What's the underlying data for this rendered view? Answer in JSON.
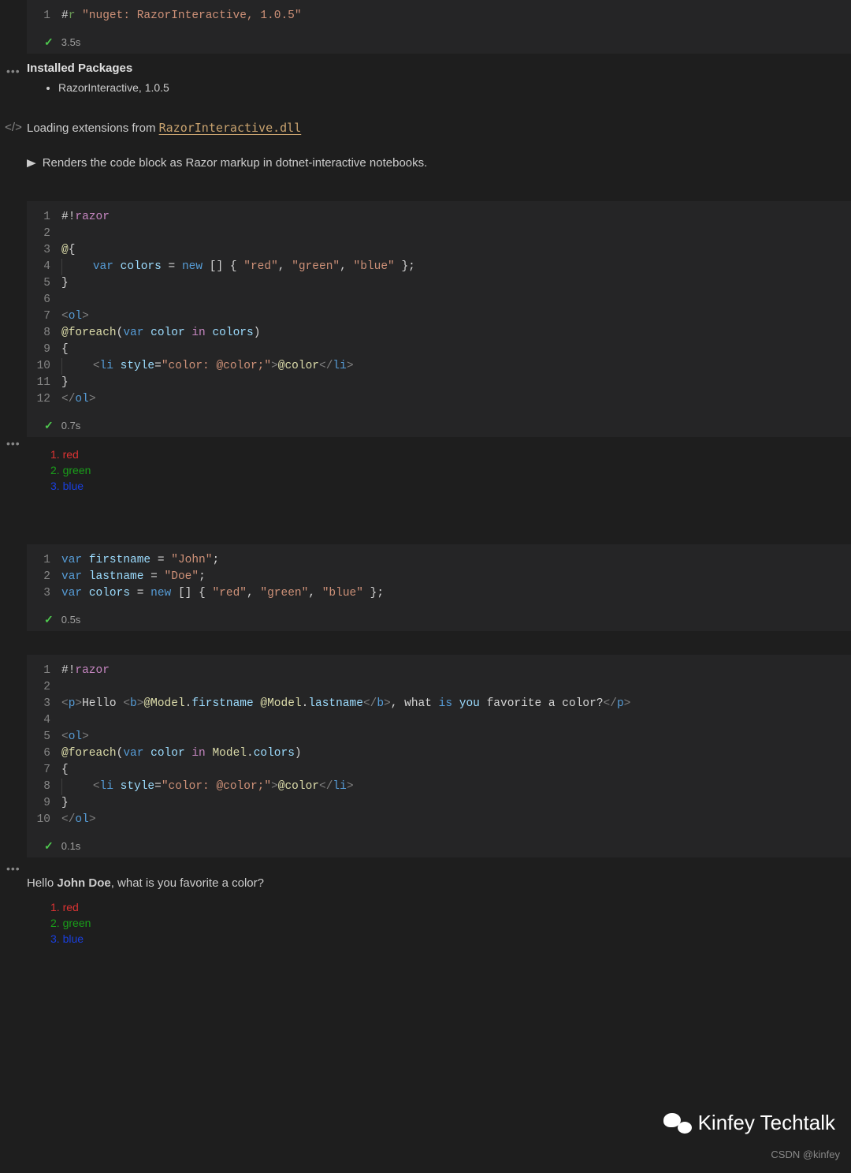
{
  "cell1": {
    "lines": [
      {
        "n": "1",
        "tokens": [
          [
            "pn",
            "#"
          ],
          [
            "cm",
            "r "
          ],
          [
            "str",
            "\"nuget: RazorInteractive, 1.0.5\""
          ]
        ]
      }
    ],
    "time": "3.5s"
  },
  "installed": {
    "heading": "Installed Packages",
    "items": [
      "RazorInteractive, 1.0.5"
    ]
  },
  "loading": {
    "prefix": "Loading extensions from ",
    "file": "RazorInteractive.dll"
  },
  "rendersLine": "Renders the code block as Razor markup in dotnet-interactive notebooks.",
  "cell2": {
    "lines": [
      {
        "n": "1",
        "tokens": [
          [
            "pn",
            "#!"
          ],
          [
            "pr",
            "razor"
          ]
        ]
      },
      {
        "n": "2",
        "tokens": []
      },
      {
        "n": "3",
        "tokens": [
          [
            "fn",
            "@"
          ],
          [
            "pn",
            "{"
          ]
        ]
      },
      {
        "n": "4",
        "tokens": [
          [
            "gut",
            " "
          ],
          [
            "pn",
            "   "
          ],
          [
            "kw",
            "var"
          ],
          [
            "pn",
            " "
          ],
          [
            "vr",
            "colors"
          ],
          [
            "pn",
            " = "
          ],
          [
            "kw",
            "new"
          ],
          [
            "pn",
            " [] { "
          ],
          [
            "str",
            "\"red\""
          ],
          [
            "pn",
            ", "
          ],
          [
            "str",
            "\"green\""
          ],
          [
            "pn",
            ", "
          ],
          [
            "str",
            "\"blue\""
          ],
          [
            "pn",
            " };"
          ]
        ]
      },
      {
        "n": "5",
        "tokens": [
          [
            "pn",
            "}"
          ]
        ]
      },
      {
        "n": "6",
        "tokens": []
      },
      {
        "n": "7",
        "tokens": [
          [
            "ang",
            "<"
          ],
          [
            "tag",
            "ol"
          ],
          [
            "ang",
            ">"
          ]
        ]
      },
      {
        "n": "8",
        "tokens": [
          [
            "fn",
            "@foreach"
          ],
          [
            "pn",
            "("
          ],
          [
            "kw",
            "var"
          ],
          [
            "pn",
            " "
          ],
          [
            "vr",
            "color"
          ],
          [
            "pn",
            " "
          ],
          [
            "pr",
            "in"
          ],
          [
            "pn",
            " "
          ],
          [
            "vr",
            "colors"
          ],
          [
            "pn",
            ")"
          ]
        ]
      },
      {
        "n": "9",
        "tokens": [
          [
            "pn",
            "{"
          ]
        ]
      },
      {
        "n": "10",
        "tokens": [
          [
            "gut",
            " "
          ],
          [
            "pn",
            "   "
          ],
          [
            "ang",
            "<"
          ],
          [
            "tag",
            "li"
          ],
          [
            "pn",
            " "
          ],
          [
            "attr",
            "style"
          ],
          [
            "pn",
            "="
          ],
          [
            "str",
            "\"color: @color;\""
          ],
          [
            "ang",
            ">"
          ],
          [
            "fn",
            "@color"
          ],
          [
            "ang",
            "</"
          ],
          [
            "tag",
            "li"
          ],
          [
            "ang",
            ">"
          ]
        ]
      },
      {
        "n": "11",
        "tokens": [
          [
            "pn",
            "}"
          ]
        ]
      },
      {
        "n": "12",
        "tokens": [
          [
            "ang",
            "</"
          ],
          [
            "tag",
            "ol"
          ],
          [
            "ang",
            ">"
          ]
        ]
      }
    ],
    "time": "0.7s"
  },
  "output1": [
    {
      "n": "1.",
      "label": "red",
      "color": "#dd3333"
    },
    {
      "n": "2.",
      "label": "green",
      "color": "#1a9e1a"
    },
    {
      "n": "3.",
      "label": "blue",
      "color": "#1a3fdd"
    }
  ],
  "cell3": {
    "lines": [
      {
        "n": "1",
        "tokens": [
          [
            "kw",
            "var"
          ],
          [
            "pn",
            " "
          ],
          [
            "vr",
            "firstname"
          ],
          [
            "pn",
            " = "
          ],
          [
            "str",
            "\"John\""
          ],
          [
            "pn",
            ";"
          ]
        ]
      },
      {
        "n": "2",
        "tokens": [
          [
            "kw",
            "var"
          ],
          [
            "pn",
            " "
          ],
          [
            "vr",
            "lastname"
          ],
          [
            "pn",
            " = "
          ],
          [
            "str",
            "\"Doe\""
          ],
          [
            "pn",
            ";"
          ]
        ]
      },
      {
        "n": "3",
        "tokens": [
          [
            "kw",
            "var"
          ],
          [
            "pn",
            " "
          ],
          [
            "vr",
            "colors"
          ],
          [
            "pn",
            " = "
          ],
          [
            "kw",
            "new"
          ],
          [
            "pn",
            " [] { "
          ],
          [
            "str",
            "\"red\""
          ],
          [
            "pn",
            ", "
          ],
          [
            "str",
            "\"green\""
          ],
          [
            "pn",
            ", "
          ],
          [
            "str",
            "\"blue\""
          ],
          [
            "pn",
            " };"
          ]
        ]
      }
    ],
    "time": "0.5s"
  },
  "cell4": {
    "lines": [
      {
        "n": "1",
        "tokens": [
          [
            "pn",
            "#!"
          ],
          [
            "pr",
            "razor"
          ]
        ]
      },
      {
        "n": "2",
        "tokens": []
      },
      {
        "n": "3",
        "tokens": [
          [
            "ang",
            "<"
          ],
          [
            "tag",
            "p"
          ],
          [
            "ang",
            ">"
          ],
          [
            "pn",
            "Hello "
          ],
          [
            "ang",
            "<"
          ],
          [
            "tag",
            "b"
          ],
          [
            "ang",
            ">"
          ],
          [
            "fn",
            "@Model"
          ],
          [
            "pn",
            "."
          ],
          [
            "vr",
            "firstname"
          ],
          [
            "pn",
            " "
          ],
          [
            "fn",
            "@Model"
          ],
          [
            "pn",
            "."
          ],
          [
            "vr",
            "lastname"
          ],
          [
            "ang",
            "</"
          ],
          [
            "tag",
            "b"
          ],
          [
            "ang",
            ">"
          ],
          [
            "pn",
            ", what "
          ],
          [
            "kw",
            "is"
          ],
          [
            "pn",
            " "
          ],
          [
            "vr",
            "you"
          ],
          [
            "pn",
            " favorite a color?"
          ],
          [
            "ang",
            "</"
          ],
          [
            "tag",
            "p"
          ],
          [
            "ang",
            ">"
          ]
        ]
      },
      {
        "n": "4",
        "tokens": []
      },
      {
        "n": "5",
        "tokens": [
          [
            "ang",
            "<"
          ],
          [
            "tag",
            "ol"
          ],
          [
            "ang",
            ">"
          ]
        ]
      },
      {
        "n": "6",
        "tokens": [
          [
            "fn",
            "@foreach"
          ],
          [
            "pn",
            "("
          ],
          [
            "kw",
            "var"
          ],
          [
            "pn",
            " "
          ],
          [
            "vr",
            "color"
          ],
          [
            "pn",
            " "
          ],
          [
            "pr",
            "in"
          ],
          [
            "pn",
            " "
          ],
          [
            "fn",
            "Model"
          ],
          [
            "pn",
            "."
          ],
          [
            "vr",
            "colors"
          ],
          [
            "pn",
            ")"
          ]
        ]
      },
      {
        "n": "7",
        "tokens": [
          [
            "pn",
            "{"
          ]
        ]
      },
      {
        "n": "8",
        "tokens": [
          [
            "gut",
            " "
          ],
          [
            "pn",
            "   "
          ],
          [
            "ang",
            "<"
          ],
          [
            "tag",
            "li"
          ],
          [
            "pn",
            " "
          ],
          [
            "attr",
            "style"
          ],
          [
            "pn",
            "="
          ],
          [
            "str",
            "\"color: @color;\""
          ],
          [
            "ang",
            ">"
          ],
          [
            "fn",
            "@color"
          ],
          [
            "ang",
            "</"
          ],
          [
            "tag",
            "li"
          ],
          [
            "ang",
            ">"
          ]
        ]
      },
      {
        "n": "9",
        "tokens": [
          [
            "pn",
            "}"
          ]
        ]
      },
      {
        "n": "10",
        "tokens": [
          [
            "ang",
            "</"
          ],
          [
            "tag",
            "ol"
          ],
          [
            "ang",
            ">"
          ]
        ]
      }
    ],
    "time": "0.1s"
  },
  "hello": {
    "prefix": "Hello ",
    "bold": "John Doe",
    "suffix": ", what is you favorite a color?"
  },
  "output2": [
    {
      "n": "1.",
      "label": "red",
      "color": "#dd3333"
    },
    {
      "n": "2.",
      "label": "green",
      "color": "#1a9e1a"
    },
    {
      "n": "3.",
      "label": "blue",
      "color": "#1a3fdd"
    }
  ],
  "watermark": "Kinfey Techtalk",
  "csdn": "CSDN @kinfey"
}
